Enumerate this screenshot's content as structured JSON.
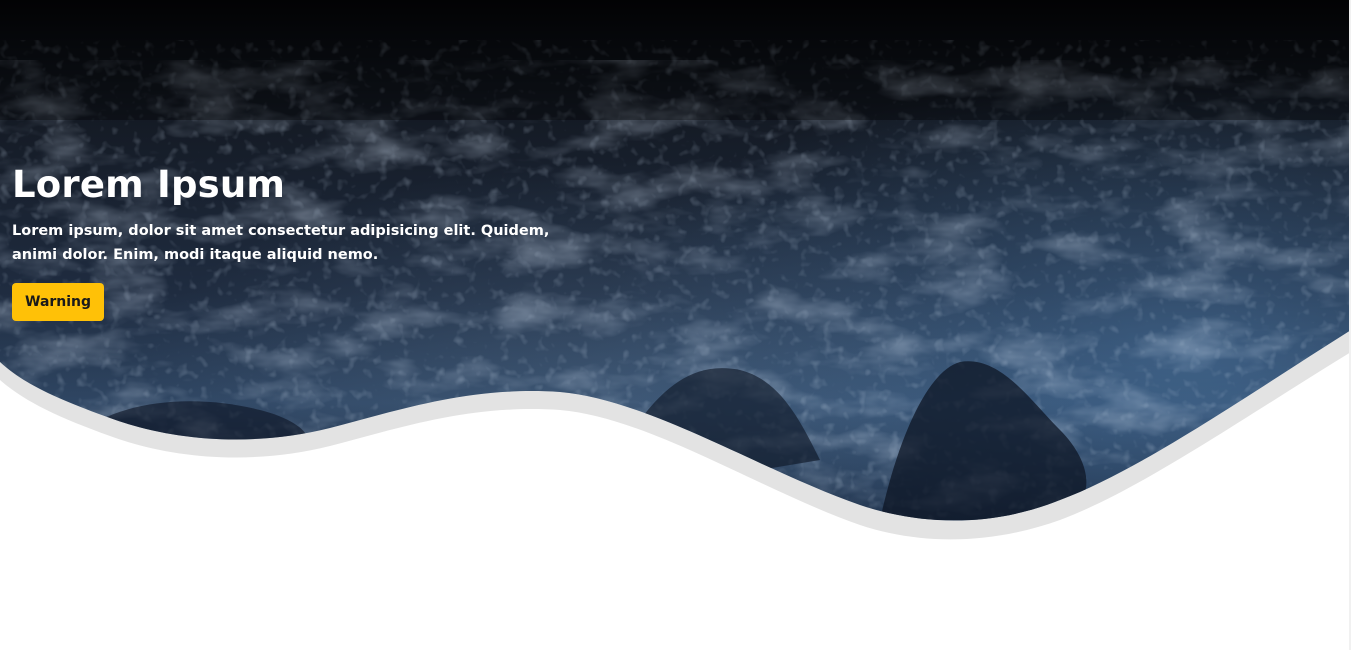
{
  "hero": {
    "title": "Lorem Ipsum",
    "text": "Lorem ipsum, dolor sit amet consectetur adipisicing elit. Quidem, animi dolor. Enim, modi itaque aliquid nemo.",
    "button_label": "Warning"
  },
  "colors": {
    "button_bg": "#ffc107",
    "hero_dark": "#05070c",
    "hero_mid": "#1c2c44",
    "hero_light": "#3d5f86",
    "wave_shadow": "#e3e3e3",
    "page_bg": "#ffffff"
  },
  "icons": {
    "hero_background": "ocean-waves-image"
  }
}
